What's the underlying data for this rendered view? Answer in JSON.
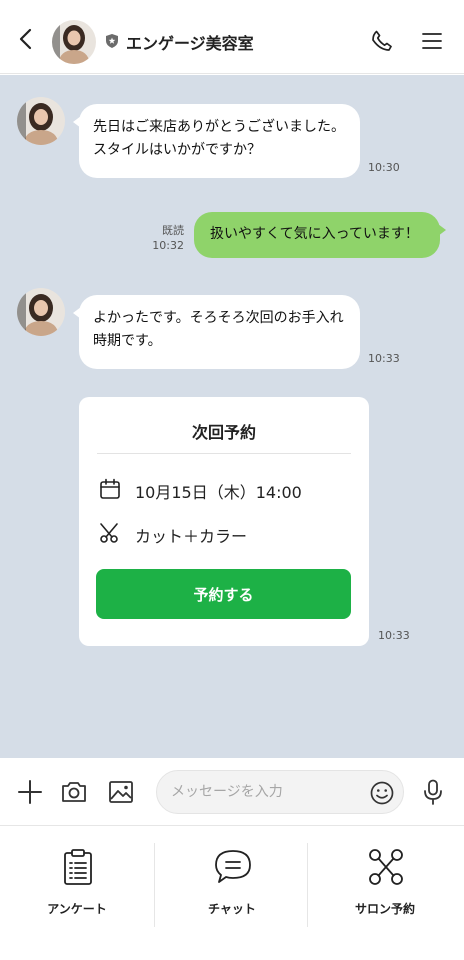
{
  "header": {
    "title": "エンゲージ美容室"
  },
  "messages": [
    {
      "side": "left",
      "text": "先日はご来店ありがとうございました。\nスタイルはいかがですか？",
      "time": "10:30"
    },
    {
      "side": "right",
      "text": "扱いやすくて気に入っています！",
      "time": "10:32",
      "read": "既読"
    },
    {
      "side": "left",
      "text": "よかったです。そろそろ次回のお手入れ\n時期です。",
      "time": "10:33"
    }
  ],
  "booking": {
    "title": "次回予約",
    "date": "10月15日（木）14:00",
    "menu": "カット＋カラー",
    "button": "予約する",
    "time": "10:33"
  },
  "input": {
    "placeholder": "メッセージを入力"
  },
  "bottom_menu": [
    {
      "label": "アンケート",
      "icon": "clipboard-icon"
    },
    {
      "label": "チャット",
      "icon": "chat-bubble-icon"
    },
    {
      "label": "サロン予約",
      "icon": "scissors-icon"
    }
  ],
  "colors": {
    "chat_bg": "#d5dde7",
    "my_bubble": "#8fd36a",
    "accent_green": "#1db146"
  }
}
